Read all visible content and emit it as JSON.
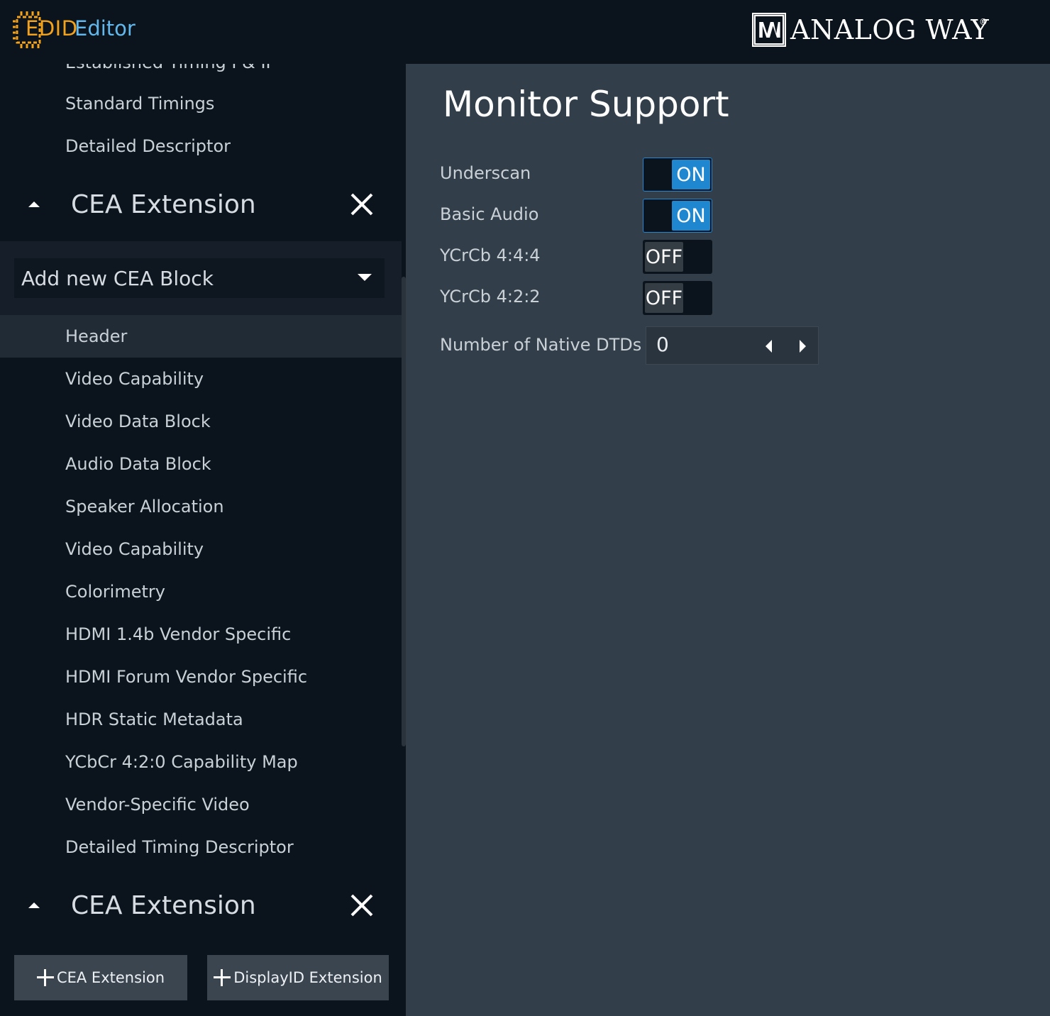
{
  "header": {
    "app_title_part1": "EDID",
    "app_title_part2": "Editor",
    "brand": "ANALOG WAY",
    "brand_reg": "®"
  },
  "sidebar": {
    "partial_item": "Established Timing I & II",
    "top_items": [
      {
        "label": "Standard Timings"
      },
      {
        "label": "Detailed Descriptor"
      }
    ],
    "sections": [
      {
        "title": "CEA Extension"
      },
      {
        "title": "CEA Extension"
      }
    ],
    "add_block": {
      "label": "Add new CEA Block"
    },
    "items": [
      {
        "label": "Header",
        "active": true
      },
      {
        "label": "Video Capability"
      },
      {
        "label": "Video Data Block"
      },
      {
        "label": "Audio Data Block"
      },
      {
        "label": "Speaker Allocation"
      },
      {
        "label": "Video Capability"
      },
      {
        "label": "Colorimetry"
      },
      {
        "label": "HDMI 1.4b Vendor Specific"
      },
      {
        "label": "HDMI Forum Vendor Specific"
      },
      {
        "label": "HDR Static Metadata"
      },
      {
        "label": "YCbCr 4:2:0 Capability Map"
      },
      {
        "label": "Vendor-Specific Video"
      },
      {
        "label": "Detailed Timing Descriptor"
      }
    ],
    "buttons": {
      "cea": "CEA Extension",
      "displayid": "DisplayID Extension"
    }
  },
  "main": {
    "title": "Monitor Support",
    "fields": [
      {
        "label": "Underscan",
        "state": "ON"
      },
      {
        "label": "Basic Audio",
        "state": "ON"
      },
      {
        "label": "YCrCb 4:4:4",
        "state": "OFF"
      },
      {
        "label": "YCrCb 4:2:2",
        "state": "OFF"
      }
    ],
    "native_dtds": {
      "label": "Number of Native DTDs",
      "value": "0"
    }
  },
  "colors": {
    "accent_blue": "#1f86d0",
    "logo_orange": "#f2a21c",
    "logo_blue": "#62b8ec",
    "sidebar_bg": "#0b141d",
    "main_bg": "#323e4a"
  }
}
